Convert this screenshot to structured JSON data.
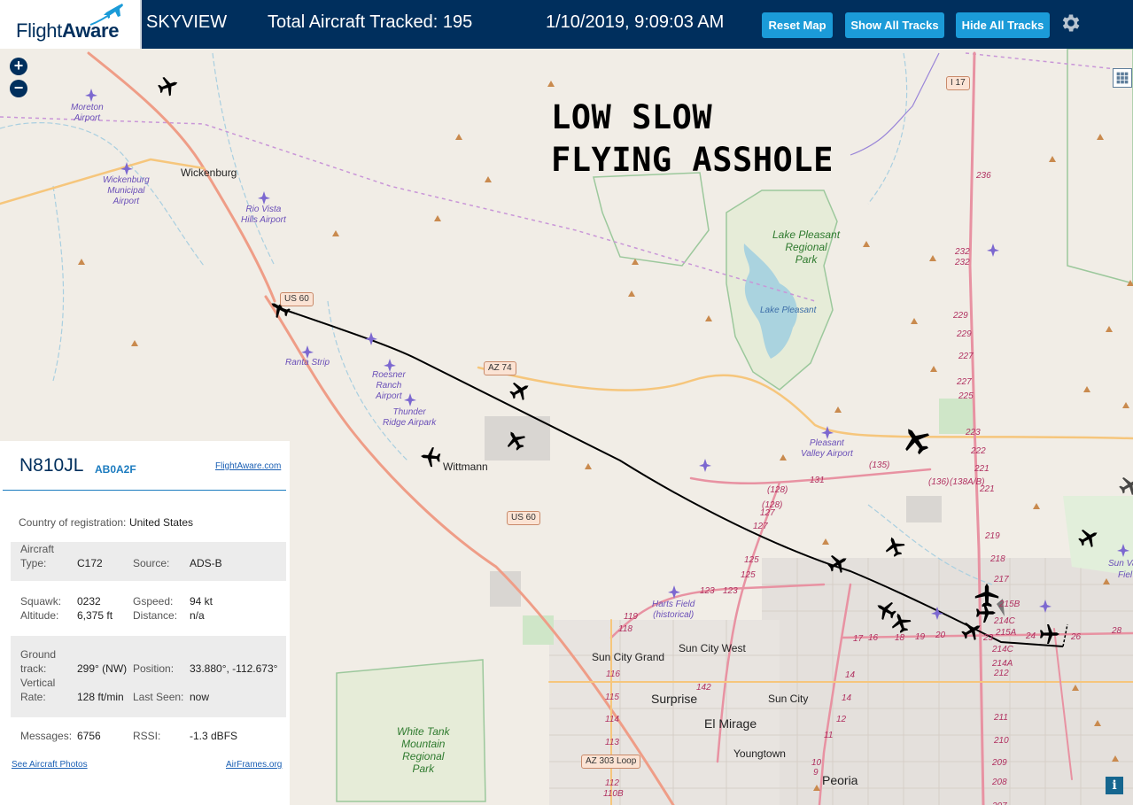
{
  "header": {
    "logo_flight": "Flight",
    "logo_aware": "Aware",
    "view_name": "SKYVIEW",
    "tracked_label": "Total Aircraft Tracked:",
    "tracked_count": "195",
    "datetime": "1/10/2019, 9:09:03 AM",
    "btn_reset": "Reset Map",
    "btn_show_tracks": "Show All Tracks",
    "btn_hide_tracks": "Hide All Tracks",
    "settings_icon": "gear-icon"
  },
  "map": {
    "zoom_in": "+",
    "zoom_out": "−",
    "info": "i",
    "annotation_line1": "LOW SLOW",
    "annotation_line2": "FLYING ASSHOLE",
    "towns": {
      "wickenburg": "Wickenburg",
      "wittmann": "Wittmann",
      "sun_city_grand": "Sun City Grand",
      "sun_city_west": "Sun City West",
      "surprise": "Surprise",
      "sun_city": "Sun City",
      "el_mirage": "El Mirage",
      "youngtown": "Youngtown",
      "peoria": "Peoria"
    },
    "airports": {
      "moreton": "Moreton\nAirport",
      "wickenburg_muni": "Wickenburg\nMunicipal\nAirport",
      "rio_vista": "Rio Vista\nHills Airport",
      "ranta": "Ranta Strip",
      "roesner": "Roesner\nRanch\nAirport",
      "thunder_ridge": "Thunder\nRidge Airpark",
      "pleasant_valley": "Pleasant\nValley Airport",
      "harts_field": "Harts Field\n(historical)"
    },
    "parks": {
      "lake_pleasant_park": "Lake Pleasant\nRegional\nPark",
      "white_tank": "White Tank\nMountain\nRegional\nPark"
    },
    "water": {
      "lake_pleasant": "Lake Pleasant"
    },
    "shields": {
      "i17": "I 17",
      "us60_north": "US 60",
      "az74": "AZ 74",
      "us60_south": "US 60",
      "az303": "AZ 303 Loop"
    },
    "highway_labels": [
      "236",
      "232",
      "232",
      "229",
      "229",
      "227",
      "227",
      "225",
      "223",
      "222",
      "221",
      "221",
      "219",
      "218",
      "217",
      "215B",
      "214C",
      "215A",
      "214C",
      "214A",
      "212",
      "211",
      "210",
      "209",
      "208",
      "207",
      "(135)",
      "(136)",
      "(138A/B)",
      "131",
      "(128)",
      "(128)",
      "127",
      "127",
      "125",
      "125",
      "123",
      "123",
      "119",
      "118",
      "116",
      "115",
      "114",
      "113",
      "112",
      "110B",
      "142",
      "14",
      "14",
      "12",
      "11",
      "10",
      "9",
      "17",
      "16",
      "18",
      "19",
      "20",
      "23",
      "24",
      "26",
      "28"
    ],
    "edge_labels": {
      "sun_valley": "Sun Va",
      "sun_valley_2": "Fiel"
    }
  },
  "panel": {
    "ident": "N810JL",
    "hex": "AB0A2F",
    "fa_link": "FlightAware.com",
    "country_label": "Country of registration:",
    "country_value": "United States",
    "aircraft_type_label": "Aircraft\nType:",
    "aircraft_type_value": "C172",
    "source_label": "Source:",
    "source_value": "ADS-B",
    "squawk_label": "Squawk:",
    "squawk_value": "0232",
    "gspeed_label": "Gspeed:",
    "gspeed_value": "94 kt",
    "altitude_label": "Altitude:",
    "altitude_value": "6,375 ft",
    "distance_label": "Distance:",
    "distance_value": "n/a",
    "track_label": "Ground\ntrack:",
    "track_value": "299° (NW)",
    "position_label": "Position:",
    "position_value": "33.880°, -112.673°",
    "vrate_label": "Vertical\nRate:",
    "vrate_value": "128 ft/min",
    "lastseen_label": "Last Seen:",
    "lastseen_value": "now",
    "messages_label": "Messages:",
    "messages_value": "6756",
    "rssi_label": "RSSI:",
    "rssi_value": "-1.3 dBFS",
    "photos_link": "See Aircraft Photos",
    "airframes_link": "AirFrames.org"
  }
}
